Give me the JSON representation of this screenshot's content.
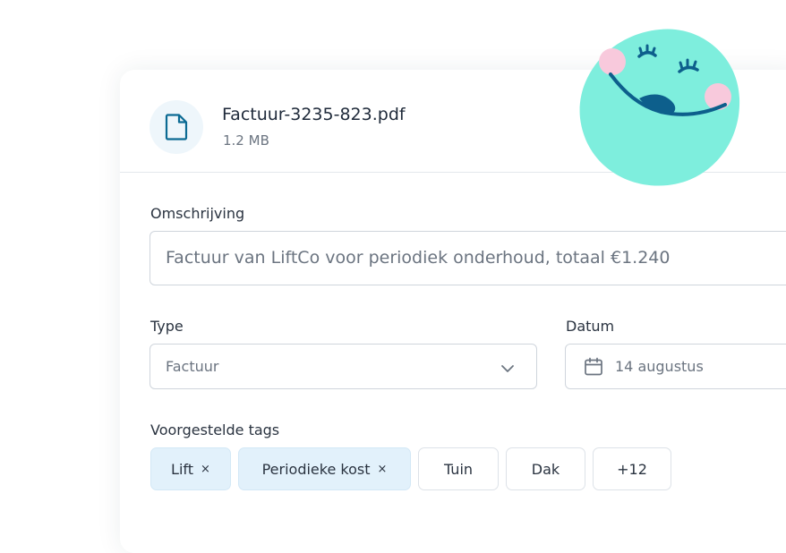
{
  "file": {
    "name": "Factuur-3235-823.pdf",
    "size": "1.2 MB",
    "icon": "document-icon"
  },
  "description": {
    "label": "Omschrijving",
    "value": "Factuur van LiftCo voor periodiek onderhoud, totaal €1.240"
  },
  "type": {
    "label": "Type",
    "value": "Factuur",
    "icon": "chevron-down-icon"
  },
  "date": {
    "label": "Datum",
    "value": "14 augustus",
    "icon": "calendar-icon"
  },
  "tags": {
    "label": "Voorgestelde tags",
    "selected": [
      {
        "label": "Lift",
        "remove": "×"
      },
      {
        "label": "Periodieke kost",
        "remove": "×"
      }
    ],
    "suggestions": [
      {
        "label": "Tuin"
      },
      {
        "label": "Dak"
      }
    ],
    "more": "+12"
  },
  "colors": {
    "accent": "#0b6a93",
    "tag_selected_bg": "#e2f1fb",
    "mascot_face": "#7eeedd",
    "mascot_cheeks": "#f8c9dc",
    "mascot_features": "#0d5f8c"
  }
}
